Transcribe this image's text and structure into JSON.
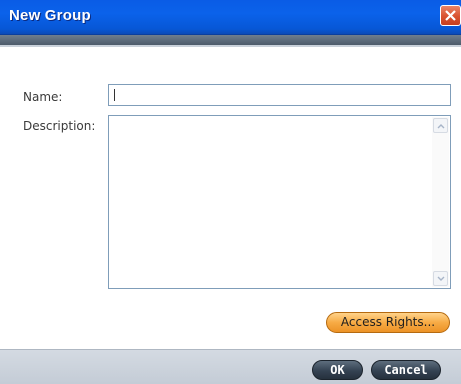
{
  "window": {
    "title": "New Group",
    "close_icon": "close-icon"
  },
  "form": {
    "name_label": "Name:",
    "name_value": "",
    "description_label": "Description:",
    "description_value": ""
  },
  "buttons": {
    "access_rights": "Access Rights...",
    "ok": "OK",
    "cancel": "Cancel"
  },
  "colors": {
    "titlebar": "#0a5ce6",
    "accent_orange": "#f7ab45",
    "dark_button": "#344252"
  }
}
